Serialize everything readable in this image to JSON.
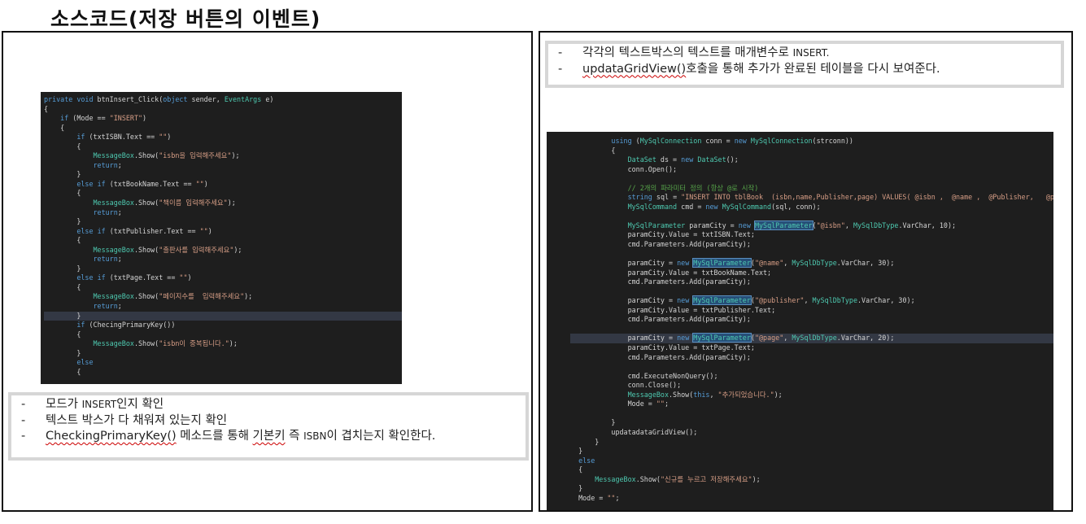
{
  "page_title": "소스코드(저장 버튼의 이벤트)",
  "left_code": [
    "private void btnInsert_Click(object sender, EventArgs e)",
    "{",
    "    if (Mode == \"INSERT\")",
    "    {",
    "        if (txtISBN.Text == \"\")",
    "        {",
    "            MessageBox.Show(\"isbn을 입력해주세요\");",
    "            return;",
    "        }",
    "        else if (txtBookName.Text == \"\")",
    "        {",
    "            MessageBox.Show(\"책이름 입력해주세요\");",
    "            return;",
    "        }",
    "        else if (txtPublisher.Text == \"\")",
    "        {",
    "            MessageBox.Show(\"출판사를 입력해주세요\");",
    "            return;",
    "        }",
    "        else if (txtPage.Text == \"\")",
    "        {",
    "            MessageBox.Show(\"페이지수를  입력해주세요\");",
    "            return;",
    "        }",
    "        if (ChecingPrimaryKey())",
    "        {",
    "            MessageBox.Show(\"isbn이 중복됩니다.\");",
    "        }",
    "        else",
    "        {"
  ],
  "left_notes": [
    {
      "dash": "-",
      "parts": [
        {
          "t": "모드가 "
        },
        {
          "t": "INSERT",
          "sc": true
        },
        {
          "t": "인지 확인"
        }
      ]
    },
    {
      "dash": "-",
      "parts": [
        {
          "t": "텍스트 박스가 다 채워져 있는지 확인"
        }
      ]
    },
    {
      "dash": "-",
      "parts": [
        {
          "t": "CheckingPrimaryKey()",
          "wavy": true
        },
        {
          "t": " 메소드를 통해 "
        },
        {
          "t": "기본키",
          "wavy": true
        },
        {
          "t": " 즉 "
        },
        {
          "t": "ISBN",
          "sc": true
        },
        {
          "t": "이 겹치는지 확인한다."
        }
      ]
    }
  ],
  "right_notes": [
    {
      "dash": "-",
      "parts": [
        {
          "t": "각각의 텍스트박스의 텍스트를 매개변수로 "
        },
        {
          "t": "INSERT.",
          "sc": true
        }
      ]
    },
    {
      "dash": "-",
      "parts": [
        {
          "t": "updataGridView()",
          "wavy": true
        },
        {
          "t": "호출을 통해 추가가 완료된 테이블을 다시 보여준다."
        }
      ]
    }
  ],
  "right_code": [
    "          using (MySqlConnection conn = new MySqlConnection(strconn))",
    "          {",
    "              DataSet ds = new DataSet();",
    "              conn.Open();",
    "",
    "              // 2개의 파라미터 정의 (항상 @로 시작)",
    "              string sql = \"INSERT INTO tblBook  (isbn,name,Publisher,page) VALUES( @isbn ,  @name ,  @Publisher,   @page)\";",
    "              MySqlCommand cmd = new MySqlCommand(sql, conn);",
    "",
    "              MySqlParameter paramCity = new MySqlParameter(\"@isbn\", MySqlDbType.VarChar, 10);",
    "              paramCity.Value = txtISBN.Text;",
    "              cmd.Parameters.Add(paramCity);",
    "",
    "              paramCity = new MySqlParameter(\"@name\", MySqlDbType.VarChar, 30);",
    "              paramCity.Value = txtBookName.Text;",
    "              cmd.Parameters.Add(paramCity);",
    "",
    "              paramCity = new MySqlParameter(\"@publisher\", MySqlDbType.VarChar, 30);",
    "              paramCity.Value = txtPublisher.Text;",
    "              cmd.Parameters.Add(paramCity);",
    "",
    "              paramCity = new MySqlParameter(\"@page\", MySqlDbType.VarChar, 20);",
    "              paramCity.Value = txtPage.Text;",
    "              cmd.Parameters.Add(paramCity);",
    "",
    "              cmd.ExecuteNonQuery();",
    "              conn.Close();",
    "              MessageBox.Show(this, \"추가되었습니다.\");",
    "              Mode = \"\";",
    "",
    "          }",
    "          updatadataGridView();",
    "      }",
    "  }",
    "  else",
    "  {",
    "      MessageBox.Show(\"신규를 누르고 저장해주세요\");",
    "  }",
    "  Mode = \"\";"
  ],
  "colors": {
    "code_bg": "#1e1e1e",
    "keyword": "#569cd6",
    "string": "#d69d85",
    "type": "#4ec9b0",
    "comment": "#57a64a",
    "note_border": "#d6d6d6"
  }
}
